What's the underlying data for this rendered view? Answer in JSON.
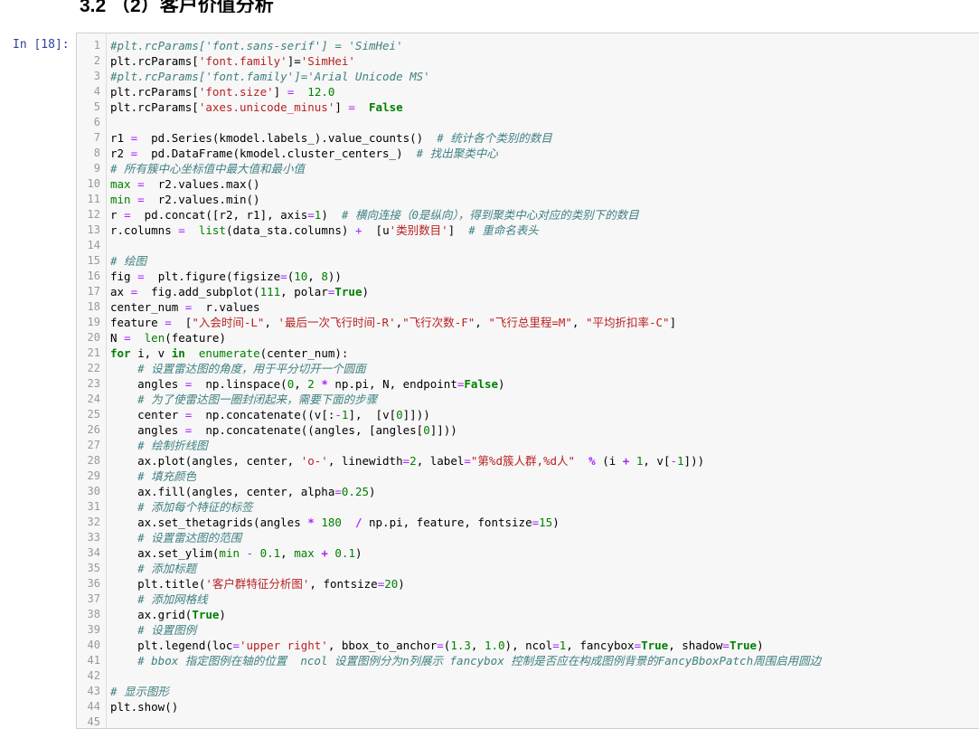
{
  "heading": "3.2  （2）客户价值分析",
  "cell": {
    "prompt": "In  [18]:",
    "lines": [
      {
        "n": "1",
        "t": [
          [
            "cm",
            "#plt.rcParams['font.sans-serif'] = 'SimHei'"
          ]
        ]
      },
      {
        "n": "2",
        "t": [
          [
            "",
            "plt.rcParams["
          ],
          [
            "st",
            "'font.family'"
          ],
          [
            "",
            "]="
          ],
          [
            "st",
            "'SimHei'"
          ]
        ]
      },
      {
        "n": "3",
        "t": [
          [
            "cm",
            "#plt.rcParams['font.family']='Arial Unicode MS'"
          ]
        ]
      },
      {
        "n": "4",
        "t": [
          [
            "",
            "plt.rcParams["
          ],
          [
            "st",
            "'font.size'"
          ],
          [
            "",
            "] "
          ],
          [
            "op2",
            "="
          ],
          [
            "",
            "  "
          ],
          [
            "nu",
            "12.0"
          ]
        ]
      },
      {
        "n": "5",
        "t": [
          [
            "",
            "plt.rcParams["
          ],
          [
            "st",
            "'axes.unicode_minus'"
          ],
          [
            "",
            "] "
          ],
          [
            "op2",
            "="
          ],
          [
            "",
            "  "
          ],
          [
            "kw",
            "False"
          ]
        ]
      },
      {
        "n": "6",
        "t": []
      },
      {
        "n": "7",
        "t": [
          [
            "",
            "r1 "
          ],
          [
            "op2",
            "="
          ],
          [
            "",
            "  pd.Series(kmodel.labels_).value_counts()  "
          ],
          [
            "cm",
            "# 统计各个类别的数目"
          ]
        ]
      },
      {
        "n": "8",
        "t": [
          [
            "",
            "r2 "
          ],
          [
            "op2",
            "="
          ],
          [
            "",
            "  pd.DataFrame(kmodel.cluster_centers_)  "
          ],
          [
            "cm",
            "# 找出聚类中心"
          ]
        ]
      },
      {
        "n": "9",
        "t": [
          [
            "cm",
            "# 所有簇中心坐标值中最大值和最小值"
          ]
        ]
      },
      {
        "n": "10",
        "t": [
          [
            "bi",
            "max"
          ],
          [
            "",
            ""
          ],
          [
            "op2",
            " ="
          ],
          [
            "",
            "  r2.values.max()"
          ]
        ]
      },
      {
        "n": "11",
        "t": [
          [
            "bi",
            "min"
          ],
          [
            "op2",
            " ="
          ],
          [
            "",
            "  r2.values.min()"
          ]
        ]
      },
      {
        "n": "12",
        "t": [
          [
            "",
            "r "
          ],
          [
            "op2",
            "="
          ],
          [
            "",
            "  pd.concat([r2, r1], axis"
          ],
          [
            "op2",
            "="
          ],
          [
            "nu",
            "1"
          ],
          [
            "",
            ")  "
          ],
          [
            "cm",
            "# 横向连接（0是纵向），得到聚类中心对应的类别下的数目"
          ]
        ]
      },
      {
        "n": "13",
        "t": [
          [
            "",
            "r.columns "
          ],
          [
            "op2",
            "="
          ],
          [
            "",
            "  "
          ],
          [
            "bi",
            "list"
          ],
          [
            "",
            "(data_sta.columns) "
          ],
          [
            "op2",
            "+"
          ],
          [
            "",
            "  [u"
          ],
          [
            "st",
            "'类别数目'"
          ],
          [
            "",
            "]  "
          ],
          [
            "cm",
            "# 重命名表头"
          ]
        ]
      },
      {
        "n": "14",
        "t": []
      },
      {
        "n": "15",
        "t": [
          [
            "cm",
            "# 绘图"
          ]
        ]
      },
      {
        "n": "16",
        "t": [
          [
            "",
            "fig "
          ],
          [
            "op2",
            "="
          ],
          [
            "",
            "  plt.figure(figsize"
          ],
          [
            "op2",
            "="
          ],
          [
            "",
            "("
          ],
          [
            "nu",
            "10"
          ],
          [
            "",
            ", "
          ],
          [
            "nu",
            "8"
          ],
          [
            "",
            "))"
          ]
        ]
      },
      {
        "n": "17",
        "t": [
          [
            "",
            "ax "
          ],
          [
            "op2",
            "="
          ],
          [
            "",
            "  fig.add_subplot("
          ],
          [
            "nu",
            "111"
          ],
          [
            "",
            ", polar"
          ],
          [
            "op2",
            "="
          ],
          [
            "kw",
            "True"
          ],
          [
            "",
            ")"
          ]
        ]
      },
      {
        "n": "18",
        "t": [
          [
            "",
            "center_num "
          ],
          [
            "op2",
            "="
          ],
          [
            "",
            "  r.values"
          ]
        ]
      },
      {
        "n": "19",
        "t": [
          [
            "",
            "feature "
          ],
          [
            "op2",
            "="
          ],
          [
            "",
            "  ["
          ],
          [
            "st",
            "\"入会时间-L\""
          ],
          [
            "",
            ", "
          ],
          [
            "st",
            "'最后一次飞行时间-R'"
          ],
          [
            "",
            ","
          ],
          [
            "st",
            "\"飞行次数-F\""
          ],
          [
            "",
            ", "
          ],
          [
            "st",
            "\"飞行总里程=M\""
          ],
          [
            "",
            ", "
          ],
          [
            "st",
            "\"平均折扣率-C\""
          ],
          [
            "",
            "]"
          ]
        ]
      },
      {
        "n": "20",
        "t": [
          [
            "",
            "N "
          ],
          [
            "op2",
            "="
          ],
          [
            "",
            "  "
          ],
          [
            "bi",
            "len"
          ],
          [
            "",
            "(feature)"
          ]
        ]
      },
      {
        "n": "21",
        "t": [
          [
            "kw",
            "for"
          ],
          [
            "",
            " i, v "
          ],
          [
            "kw",
            "in"
          ],
          [
            "",
            "  "
          ],
          [
            "bi",
            "enumerate"
          ],
          [
            "",
            "(center_num):"
          ]
        ]
      },
      {
        "n": "22",
        "t": [
          [
            "",
            "    "
          ],
          [
            "cm",
            "# 设置雷达图的角度，用于平分切开一个圆面"
          ]
        ]
      },
      {
        "n": "23",
        "t": [
          [
            "",
            "    angles "
          ],
          [
            "op2",
            "="
          ],
          [
            "",
            "  np.linspace("
          ],
          [
            "nu",
            "0"
          ],
          [
            "",
            ", "
          ],
          [
            "nu",
            "2"
          ],
          [
            "",
            " "
          ],
          [
            "op",
            "*"
          ],
          [
            "",
            " np.pi, N, endpoint"
          ],
          [
            "op2",
            "="
          ],
          [
            "kw",
            "False"
          ],
          [
            "",
            ")"
          ]
        ]
      },
      {
        "n": "24",
        "t": [
          [
            "",
            "    "
          ],
          [
            "cm",
            "# 为了使雷达图一圈封闭起来，需要下面的步骤"
          ]
        ]
      },
      {
        "n": "25",
        "t": [
          [
            "",
            "    center "
          ],
          [
            "op2",
            "="
          ],
          [
            "",
            "  np.concatenate((v[:"
          ],
          [
            "op2",
            "-"
          ],
          [
            "nu",
            "1"
          ],
          [
            "",
            "],  [v["
          ],
          [
            "nu",
            "0"
          ],
          [
            "",
            "]]))"
          ]
        ]
      },
      {
        "n": "26",
        "t": [
          [
            "",
            "    angles "
          ],
          [
            "op2",
            "="
          ],
          [
            "",
            "  np.concatenate((angles, [angles["
          ],
          [
            "nu",
            "0"
          ],
          [
            "",
            "]]))"
          ]
        ]
      },
      {
        "n": "27",
        "t": [
          [
            "",
            "    "
          ],
          [
            "cm",
            "# 绘制折线图"
          ]
        ]
      },
      {
        "n": "28",
        "t": [
          [
            "",
            "    ax.plot(angles, center, "
          ],
          [
            "st",
            "'o-'"
          ],
          [
            "",
            ", linewidth"
          ],
          [
            "op2",
            "="
          ],
          [
            "nu",
            "2"
          ],
          [
            "",
            ", label"
          ],
          [
            "op2",
            "="
          ],
          [
            "st",
            "\"第%d簇人群,%d人\""
          ],
          [
            "",
            ""
          ],
          [
            "op",
            "  %"
          ],
          [
            "",
            " (i "
          ],
          [
            "op",
            "+"
          ],
          [
            "",
            " "
          ],
          [
            "nu",
            "1"
          ],
          [
            "",
            ", v["
          ],
          [
            "op2",
            "-"
          ],
          [
            "nu",
            "1"
          ],
          [
            "",
            "]))"
          ]
        ]
      },
      {
        "n": "29",
        "t": [
          [
            "",
            "    "
          ],
          [
            "cm",
            "# 填充颜色"
          ]
        ]
      },
      {
        "n": "30",
        "t": [
          [
            "",
            "    ax.fill(angles, center, alpha"
          ],
          [
            "op2",
            "="
          ],
          [
            "nu",
            "0.25"
          ],
          [
            "",
            ")"
          ]
        ]
      },
      {
        "n": "31",
        "t": [
          [
            "",
            "    "
          ],
          [
            "cm",
            "# 添加每个特征的标签"
          ]
        ]
      },
      {
        "n": "32",
        "t": [
          [
            "",
            "    ax.set_thetagrids(angles "
          ],
          [
            "op",
            "*"
          ],
          [
            "",
            " "
          ],
          [
            "nu",
            "180"
          ],
          [
            "",
            ""
          ],
          [
            "op",
            "  /"
          ],
          [
            "",
            " np.pi, feature, fontsize"
          ],
          [
            "op2",
            "="
          ],
          [
            "nu",
            "15"
          ],
          [
            "",
            ")"
          ]
        ]
      },
      {
        "n": "33",
        "t": [
          [
            "",
            "    "
          ],
          [
            "cm",
            "# 设置雷达图的范围"
          ]
        ]
      },
      {
        "n": "34",
        "t": [
          [
            "",
            "    ax.set_ylim("
          ],
          [
            "bi",
            "min"
          ],
          [
            "",
            " "
          ],
          [
            "op2",
            "-"
          ],
          [
            "",
            " "
          ],
          [
            "nu",
            "0.1"
          ],
          [
            "",
            ", "
          ],
          [
            "bi",
            "max"
          ],
          [
            "",
            " "
          ],
          [
            "op",
            "+"
          ],
          [
            "",
            " "
          ],
          [
            "nu",
            "0.1"
          ],
          [
            "",
            ")"
          ]
        ]
      },
      {
        "n": "35",
        "t": [
          [
            "",
            "    "
          ],
          [
            "cm",
            "# 添加标题"
          ]
        ]
      },
      {
        "n": "36",
        "t": [
          [
            "",
            "    plt.title("
          ],
          [
            "st",
            "'客户群特征分析图'"
          ],
          [
            "",
            ", fontsize"
          ],
          [
            "op2",
            "="
          ],
          [
            "nu",
            "20"
          ],
          [
            "",
            ")"
          ]
        ]
      },
      {
        "n": "37",
        "t": [
          [
            "",
            "    "
          ],
          [
            "cm",
            "# 添加网格线"
          ]
        ]
      },
      {
        "n": "38",
        "t": [
          [
            "",
            "    ax.grid("
          ],
          [
            "kw",
            "True"
          ],
          [
            "",
            ")"
          ]
        ]
      },
      {
        "n": "39",
        "t": [
          [
            "",
            "    "
          ],
          [
            "cm",
            "# 设置图例"
          ]
        ]
      },
      {
        "n": "40",
        "t": [
          [
            "",
            "    plt.legend(loc"
          ],
          [
            "op2",
            "="
          ],
          [
            "st",
            "'upper right'"
          ],
          [
            "",
            ", bbox_to_anchor"
          ],
          [
            "op2",
            "="
          ],
          [
            "",
            "("
          ],
          [
            "nu",
            "1.3"
          ],
          [
            "",
            ", "
          ],
          [
            "nu",
            "1.0"
          ],
          [
            "",
            "), ncol"
          ],
          [
            "op2",
            "="
          ],
          [
            "nu",
            "1"
          ],
          [
            "",
            ", fancybox"
          ],
          [
            "op2",
            "="
          ],
          [
            "kw",
            "True"
          ],
          [
            "",
            ", shadow"
          ],
          [
            "op2",
            "="
          ],
          [
            "kw",
            "True"
          ],
          [
            "",
            ")"
          ]
        ]
      },
      {
        "n": "41",
        "t": [
          [
            "",
            "    "
          ],
          [
            "cm",
            "# bbox 指定图例在轴的位置  ncol 设置图例分为n列展示 fancybox 控制是否应在构成图例背景的FancyBboxPatch周围启用圆边"
          ]
        ]
      },
      {
        "n": "42",
        "t": []
      },
      {
        "n": "43",
        "t": [
          [
            "cm",
            "# 显示图形"
          ]
        ]
      },
      {
        "n": "44",
        "t": [
          [
            "",
            "plt.show()"
          ]
        ]
      },
      {
        "n": "45",
        "t": []
      }
    ]
  }
}
